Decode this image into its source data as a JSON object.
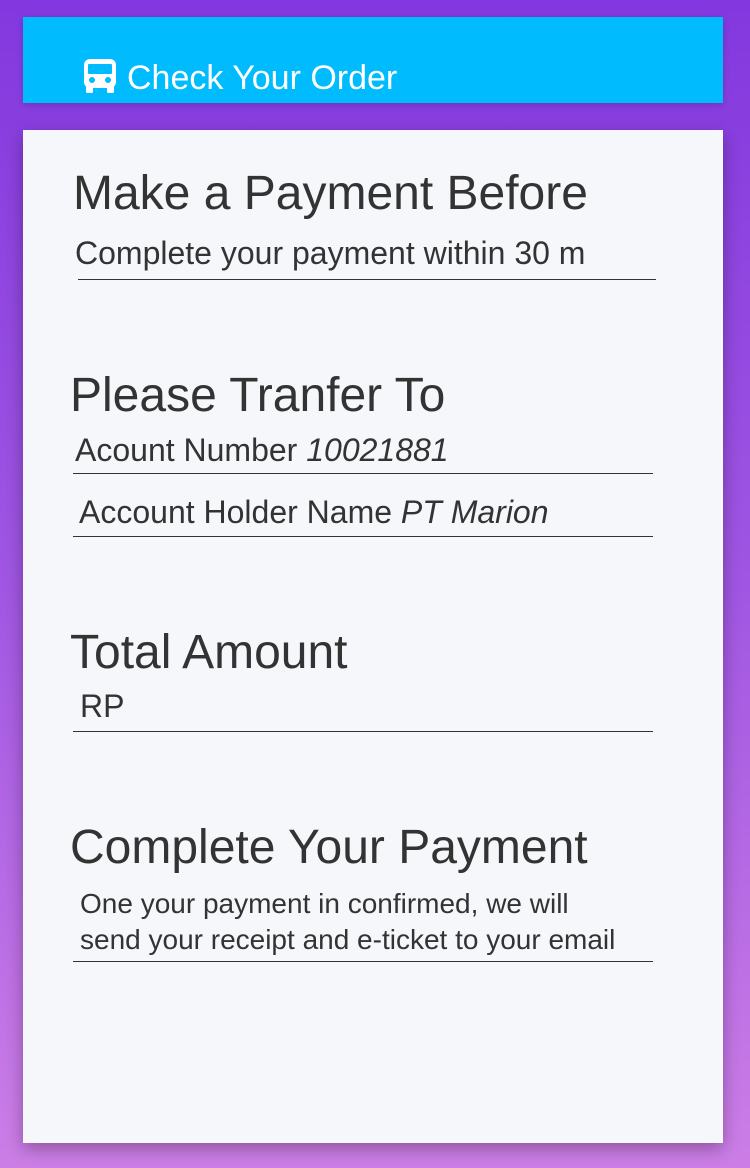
{
  "header": {
    "icon": "bus-icon",
    "title": "Check Your Order",
    "background": "#00bcff"
  },
  "payment_before": {
    "title": "Make a Payment Before",
    "text": "Complete your payment within 30 m"
  },
  "transfer": {
    "title": "Please Tranfer To",
    "account_number_label": "Acount Number",
    "account_number_value": "10021881",
    "account_holder_label": "Account Holder Name",
    "account_holder_value": "PT Marion"
  },
  "total": {
    "title": "Total Amount",
    "value": "RP"
  },
  "complete": {
    "title": "Complete Your Payment",
    "line1": "One your payment in confirmed, we will",
    "line2": "send your receipt and e-ticket to your email"
  }
}
